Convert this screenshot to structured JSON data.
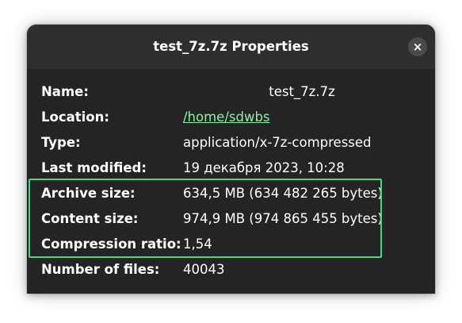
{
  "dialog": {
    "title": "test_7z.7z Properties",
    "close_icon": "close-icon",
    "close_glyph": "×"
  },
  "properties": [
    {
      "label": "Name:",
      "value": "test_7z.7z"
    },
    {
      "label": "Location:",
      "value": "/home/sdwbs"
    },
    {
      "label": "Type:",
      "value": "application/x-7z-compressed"
    },
    {
      "label": "Last modified:",
      "value": "19 декабря 2023, 10:28"
    },
    {
      "label": "Archive size:",
      "value": "634,5 MB (634 482 265 bytes)"
    },
    {
      "label": "Content size:",
      "value": "974,9 MB (974 865 455 bytes)"
    },
    {
      "label": "Compression ratio:",
      "value": "1,54"
    },
    {
      "label": "Number of files:",
      "value": "40043"
    }
  ],
  "colors": {
    "dialog_bg": "#242424",
    "header_bg": "#2e2e2e",
    "text": "#ffffff",
    "link": "#8ff0a4",
    "highlight": "#3ddc84"
  }
}
